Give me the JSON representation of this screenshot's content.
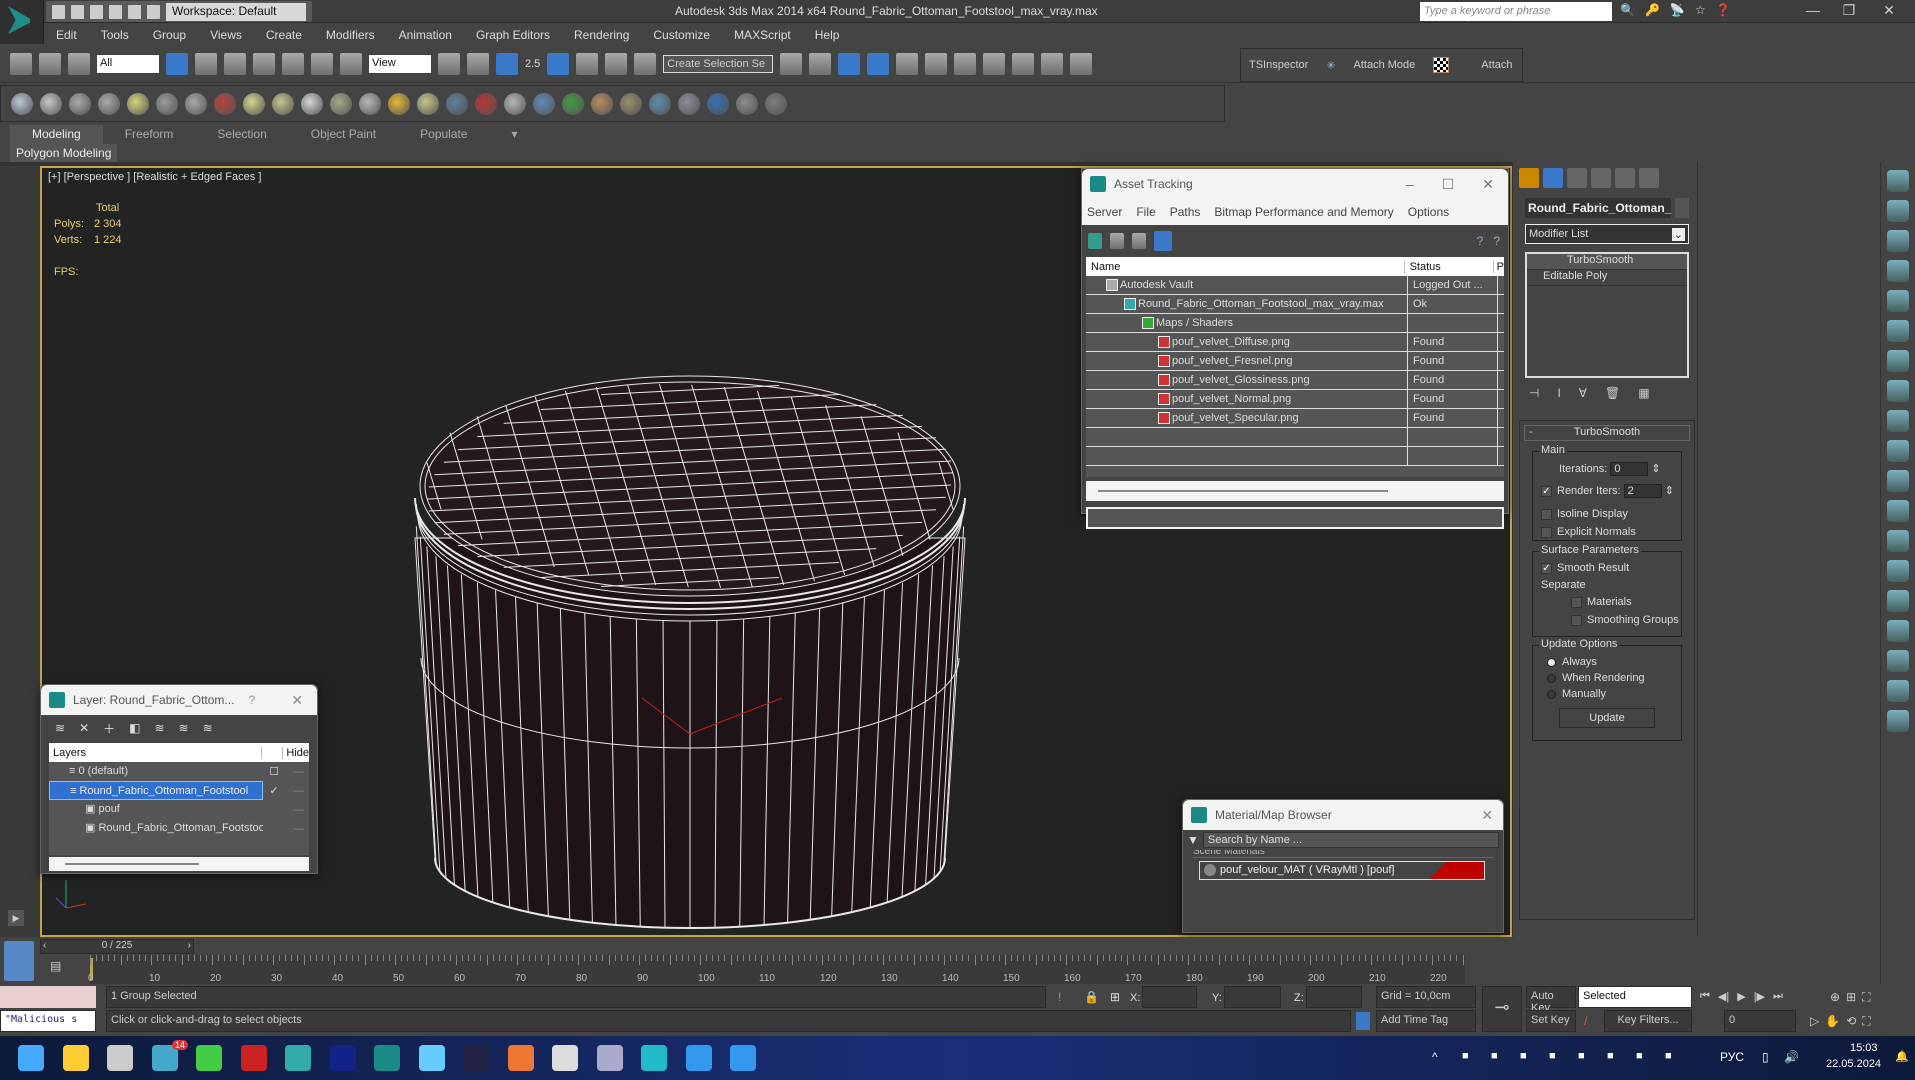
{
  "titlebar": {
    "workspace": "Workspace: Default",
    "app_title": "Autodesk 3ds Max  2014 x64    Round_Fabric_Ottoman_Footstool_max_vray.max",
    "search_placeholder": "Type a keyword or phrase"
  },
  "menu": [
    "Edit",
    "Tools",
    "Group",
    "Views",
    "Create",
    "Modifiers",
    "Animation",
    "Graph Editors",
    "Rendering",
    "Customize",
    "MAXScript",
    "Help"
  ],
  "toolbar": {
    "selection_filter": "All",
    "ref_coord": "View",
    "snap_value": "2.5",
    "named_selection": "Create Selection Se",
    "tsinspector": "TSInspector",
    "attach_mode": "Attach Mode",
    "attach": "Attach"
  },
  "ribbon": {
    "tabs": [
      "Modeling",
      "Freeform",
      "Selection",
      "Object Paint",
      "Populate"
    ],
    "active": "Modeling",
    "panel": "Polygon Modeling"
  },
  "viewport": {
    "label": "[+] [Perspective ] [Realistic + Edged Faces ]",
    "stats": {
      "total_label": "Total",
      "polys_label": "Polys:",
      "polys": "2 304",
      "verts_label": "Verts:",
      "verts": "1 224",
      "fps_label": "FPS:"
    }
  },
  "asset_tracking": {
    "title": "Asset Tracking",
    "menu": [
      "Server",
      "File",
      "Paths",
      "Bitmap Performance and Memory",
      "Options"
    ],
    "columns": [
      "Name",
      "Status",
      "P"
    ],
    "rows": [
      {
        "name": "Autodesk Vault",
        "status": "Logged Out ..."
      },
      {
        "name": "Round_Fabric_Ottoman_Footstool_max_vray.max",
        "status": "Ok"
      },
      {
        "name": "Maps / Shaders",
        "status": ""
      },
      {
        "name": "pouf_velvet_Diffuse.png",
        "status": "Found"
      },
      {
        "name": "pouf_velvet_Fresnel.png",
        "status": "Found"
      },
      {
        "name": "pouf_velvet_Glossiness.png",
        "status": "Found"
      },
      {
        "name": "pouf_velvet_Normal.png",
        "status": "Found"
      },
      {
        "name": "pouf_velvet_Specular.png",
        "status": "Found"
      }
    ]
  },
  "command_panel": {
    "object_name": "Round_Fabric_Ottoman_",
    "modifier_list": "Modifier List",
    "stack": [
      "TurboSmooth",
      "Editable Poly"
    ],
    "rollout": "TurboSmooth",
    "main": "Main",
    "iterations_label": "Iterations:",
    "iterations": "0",
    "render_iters_label": "Render Iters:",
    "render_iters": "2",
    "isoline": "Isoline Display",
    "explicit_normals": "Explicit Normals",
    "surface_params": "Surface Parameters",
    "smooth_result": "Smooth Result",
    "separate": "Separate",
    "materials": "Materials",
    "smoothing_groups": "Smoothing Groups",
    "update_options": "Update Options",
    "always": "Always",
    "when_rendering": "When Rendering",
    "manually": "Manually",
    "update_button": "Update"
  },
  "layer_dialog": {
    "title": "Layer: Round_Fabric_Ottom...",
    "help": "?",
    "col_layers": "Layers",
    "col_hide": "Hide",
    "rows": [
      "0 (default)",
      "Round_Fabric_Ottoman_Footstool",
      "pouf",
      "Round_Fabric_Ottoman_Footstoo"
    ]
  },
  "material_browser": {
    "title": "Material/Map Browser",
    "search_placeholder": "Search by Name ...",
    "group": "Scene Materials",
    "material": "pouf_velour_MAT  ( VRayMtl ) [pouf]"
  },
  "timeline": {
    "frame": "0 / 225",
    "ticks": [
      "0",
      "10",
      "20",
      "30",
      "40",
      "50",
      "60",
      "70",
      "80",
      "90",
      "100",
      "110",
      "120",
      "130",
      "140",
      "150",
      "160",
      "170",
      "180",
      "190",
      "200",
      "210",
      "220"
    ]
  },
  "status": {
    "selection": "1 Group Selected",
    "prompt": "Click or click-and-drag to select objects",
    "script": "\"Malicious s",
    "x_label": "X:",
    "y_label": "Y:",
    "z_label": "Z:",
    "grid": "Grid = 10,0cm",
    "add_time_tag": "Add Time Tag",
    "auto_key": "Auto Key",
    "set_key": "Set Key",
    "key_mode": "Selected",
    "key_filters": "Key Filters...",
    "frame_field": "0"
  },
  "taskbar": {
    "lang": "РУС",
    "time": "15:03",
    "date": "22.05.2024",
    "badge": "14"
  },
  "colors": {
    "viewport_border": "#c0a84a",
    "selection": "#3a79c9",
    "stat_text": "#e0d070",
    "material_swatch": "#c00000"
  }
}
